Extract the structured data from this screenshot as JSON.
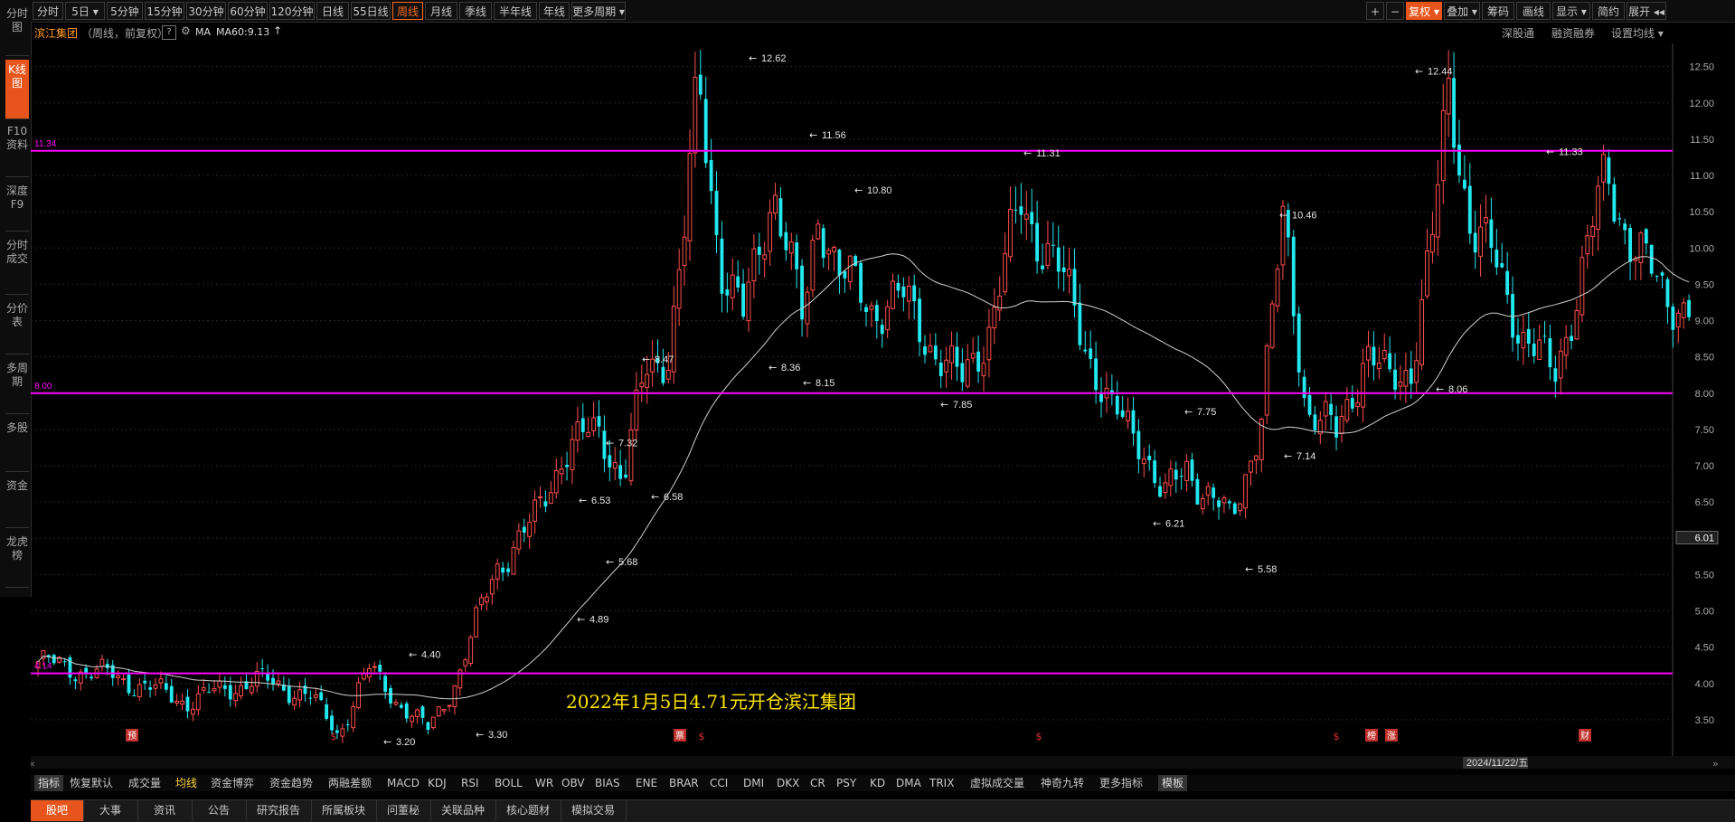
{
  "left_nav": [
    {
      "label": "分时图",
      "active": false
    },
    {
      "label": "K线图",
      "active": true
    },
    {
      "label": "F10资料",
      "active": false
    },
    {
      "label": "深度F9",
      "active": false
    },
    {
      "label": "分时成交",
      "active": false
    },
    {
      "label": "分价表",
      "active": false
    },
    {
      "label": "多周期",
      "active": false
    },
    {
      "label": "多股",
      "active": false
    },
    {
      "label": "资金",
      "active": false
    },
    {
      "label": "龙虎榜",
      "active": false
    }
  ],
  "top_periods": [
    "分时",
    "5日 ▾",
    "5分钟",
    "15分钟",
    "30分钟",
    "60分钟",
    "120分钟",
    "日线",
    "55日线",
    "周线",
    "月线",
    "季线",
    "半年线",
    "年线",
    "更多周期 ▾"
  ],
  "active_period": "周线",
  "top_right": [
    "+",
    "−",
    "复权 ▾",
    "叠加 ▾",
    "筹码",
    "画线",
    "显示 ▾",
    "简约",
    "展开 ◂◂"
  ],
  "top_right_selected": "复权 ▾",
  "info": {
    "name": "滨江集团",
    "mode": "（周线，前复权）",
    "help": "?",
    "ma_label": "MA",
    "ma_value": "MA60:9.13",
    "ma_arrow": "↑",
    "right_links": [
      "深股通",
      "融资融券",
      "设置均线 ▾"
    ]
  },
  "chart_data": {
    "type": "candlestick",
    "y_ticks": [
      "12.50",
      "12.00",
      "11.50",
      "11.00",
      "10.50",
      "10.00",
      "9.50",
      "9.00",
      "8.50",
      "8.00",
      "7.50",
      "7.00",
      "6.50",
      "6.00",
      "5.50",
      "5.00",
      "4.50",
      "4.00",
      "3.50"
    ],
    "current_price": "6.01",
    "horizontal_lines": [
      {
        "value": 11.34,
        "label": "11.34",
        "color": "#ff00ff"
      },
      {
        "value": 8.0,
        "label": "8.00",
        "color": "#ff00ff"
      },
      {
        "value": 4.14,
        "label": "4.14",
        "color": "#ff00ff"
      }
    ],
    "annotations": [
      {
        "value": 12.62,
        "label": "12.62"
      },
      {
        "value": 11.56,
        "label": "11.56"
      },
      {
        "value": 11.31,
        "label": "11.31"
      },
      {
        "value": 10.8,
        "label": "10.80"
      },
      {
        "value": 10.46,
        "label": "10.46"
      },
      {
        "value": 12.44,
        "label": "12.44"
      },
      {
        "value": 11.33,
        "label": "11.33"
      },
      {
        "value": 8.47,
        "label": "8.47"
      },
      {
        "value": 8.36,
        "label": "8.36"
      },
      {
        "value": 8.15,
        "label": "8.15"
      },
      {
        "value": 7.85,
        "label": "7.85"
      },
      {
        "value": 7.75,
        "label": "7.75"
      },
      {
        "value": 7.14,
        "label": "7.14"
      },
      {
        "value": 8.06,
        "label": "8.06"
      },
      {
        "value": 7.32,
        "label": "7.32"
      },
      {
        "value": 6.58,
        "label": "6.58"
      },
      {
        "value": 6.53,
        "label": "6.53"
      },
      {
        "value": 6.21,
        "label": "6.21"
      },
      {
        "value": 5.68,
        "label": "5.68"
      },
      {
        "value": 5.58,
        "label": "5.58"
      },
      {
        "value": 4.89,
        "label": "4.89"
      },
      {
        "value": 4.4,
        "label": "4.40"
      },
      {
        "value": 3.3,
        "label": "3.30"
      },
      {
        "value": 3.2,
        "label": "3.20"
      }
    ],
    "annotation_text": "2022年1月5日4.71元开仓滨江集团",
    "annotation_color": "#ffe600",
    "event_markers": [
      "预",
      "$",
      "$",
      "$",
      "$",
      "$",
      "$",
      "$"
    ],
    "event_markers_boxed": [
      "预",
      "票",
      "榜",
      "涨",
      "财"
    ],
    "date_label": "2024/11/22/五",
    "up_color": "#ff4d4d",
    "down_color": "#22e8f0",
    "ma_color": "#d0d0d0"
  },
  "indicators": [
    "指标",
    "恢复默认",
    "成交量",
    "均线",
    "资金博弈",
    "资金趋势",
    "两融差额",
    "MACD",
    "KDJ",
    "RSI",
    "BOLL",
    "WR",
    "OBV",
    "BIAS",
    "ENE",
    "BRAR",
    "CCI",
    "DMI",
    "DKX",
    "CR",
    "PSY",
    "KD",
    "DMA",
    "TRIX",
    "虚拟成交量",
    "神奇九转",
    "更多指标",
    "模板"
  ],
  "bottom_tabs": [
    "股吧",
    "大事",
    "资讯",
    "公告",
    "研究报告",
    "所属板块",
    "问董秘",
    "关联品种",
    "核心题材",
    "模拟交易"
  ]
}
